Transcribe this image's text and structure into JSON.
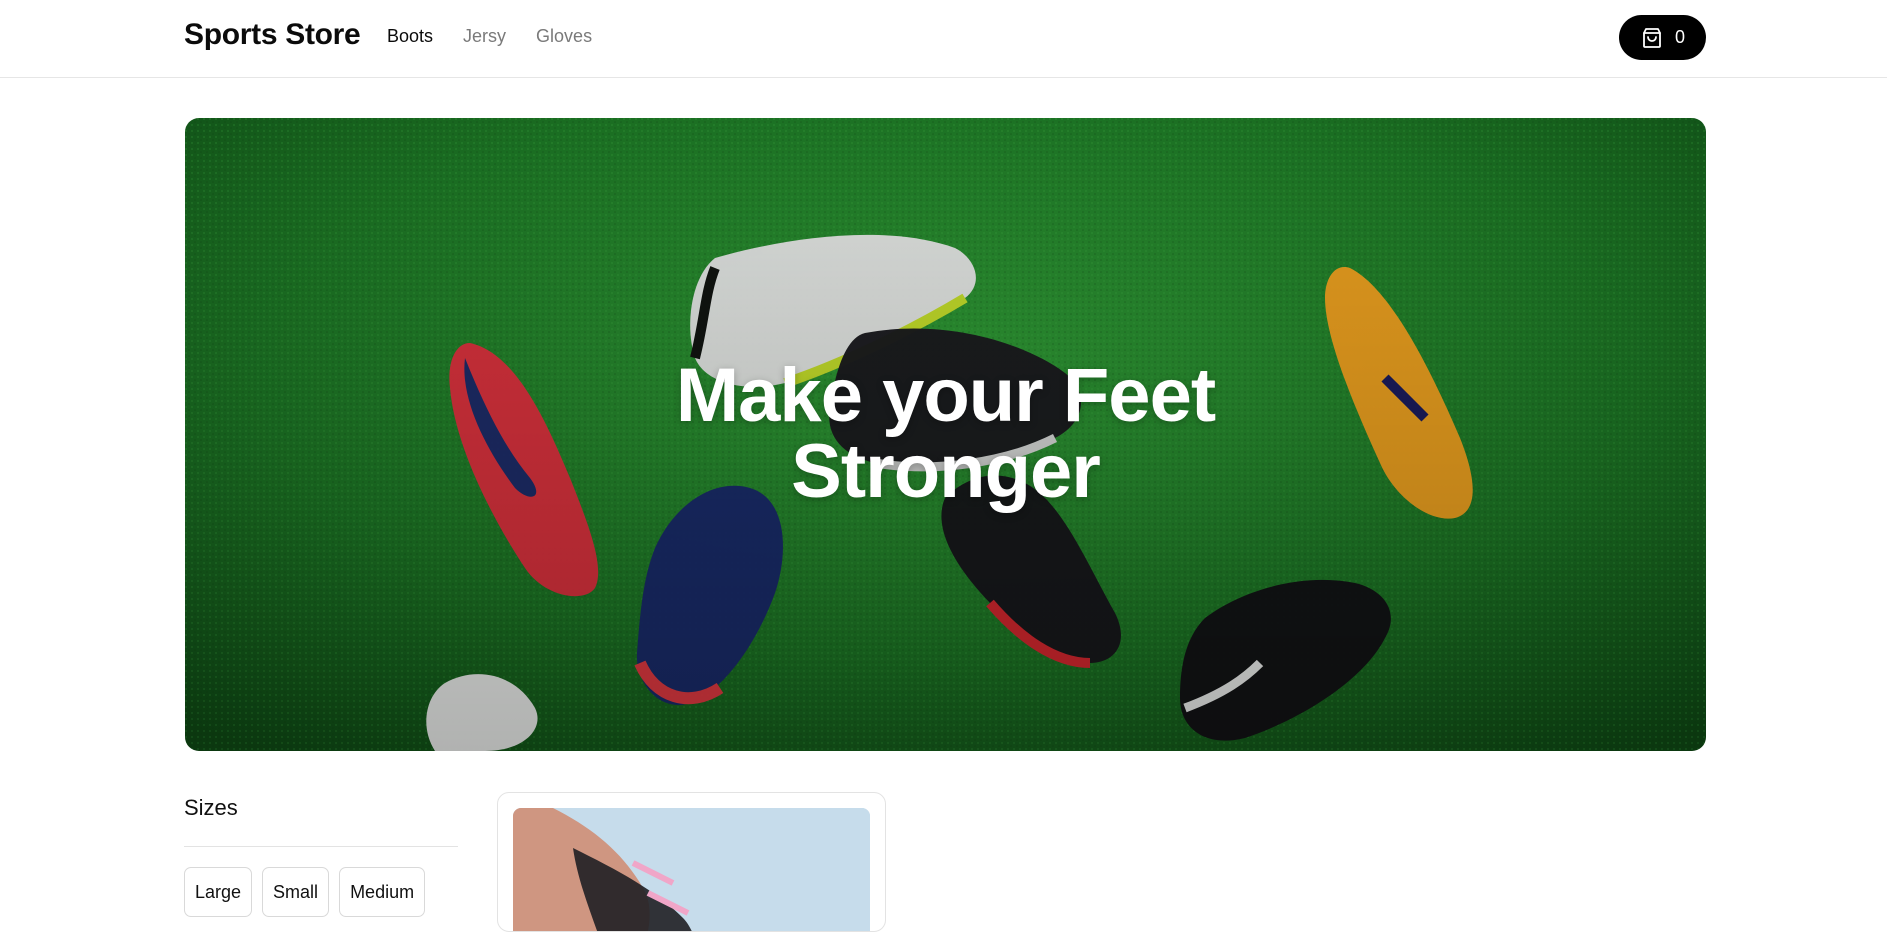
{
  "header": {
    "brand": "Sports Store",
    "nav": [
      {
        "label": "Boots",
        "active": true
      },
      {
        "label": "Jersy",
        "active": false
      },
      {
        "label": "Gloves",
        "active": false
      }
    ],
    "cart": {
      "icon": "shopping-bag-icon",
      "count": "0"
    }
  },
  "hero": {
    "title_line1": "Make your Feet",
    "title_line2": "Stronger"
  },
  "filters": {
    "title": "Sizes",
    "sizes": [
      "Large",
      "Small",
      "Medium"
    ]
  },
  "colors": {
    "accent": "#000000",
    "turf": "#1f7a2a"
  }
}
